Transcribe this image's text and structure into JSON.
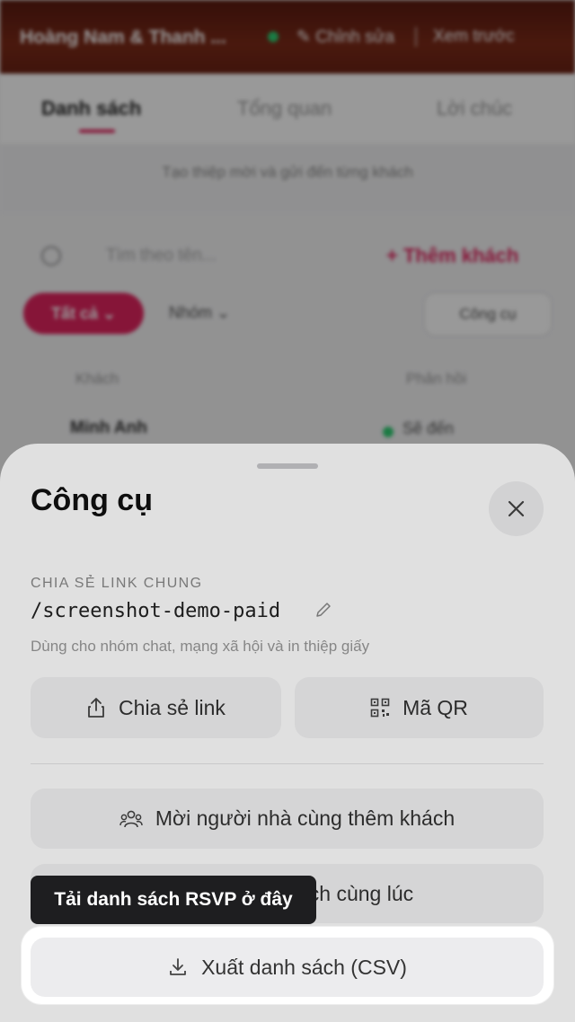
{
  "background": {
    "topbar": {
      "title": "Hoàng Nam & Thanh ...",
      "edit_label": "✎ Chỉnh sửa",
      "preview_label": "Xem trước"
    },
    "tabs": [
      {
        "label": "Danh sách"
      },
      {
        "label": "Tổng quan"
      },
      {
        "label": "Lời chúc"
      }
    ],
    "hint": "Tạo thiệp mời và gửi đến từng khách",
    "search_placeholder": "Tìm theo tên...",
    "add_guest_label": "+  Thêm khách",
    "filters": {
      "all": "Tất cả  ⌄",
      "more": "Nhóm  ⌄",
      "tools": "Công cụ"
    },
    "table": {
      "headers": [
        "Khách",
        "Phản hồi"
      ],
      "rows": [
        {
          "name": "Minh Anh",
          "status": "Sẽ đến"
        }
      ]
    }
  },
  "sheet": {
    "title": "Công cụ",
    "share_heading": "CHIA SẺ LINK CHUNG",
    "share_link": "/screenshot-demo-paid",
    "share_description": "Dùng cho nhóm chat, mạng xã hội và in thiệp giấy",
    "share_button": "Chia sẻ link",
    "qr_button": "Mã QR",
    "invite_button": "Mời người nhà cùng thêm khách",
    "bulk_button": "Thêm nhiều khách cùng lúc",
    "export_button": "Xuất danh sách (CSV)"
  },
  "tooltip": "Tải danh sách RSVP ở đây",
  "colors": {
    "accent": "#e0245e",
    "status_green": "#2ecc71",
    "tooltip_bg": "#1e1e20"
  }
}
